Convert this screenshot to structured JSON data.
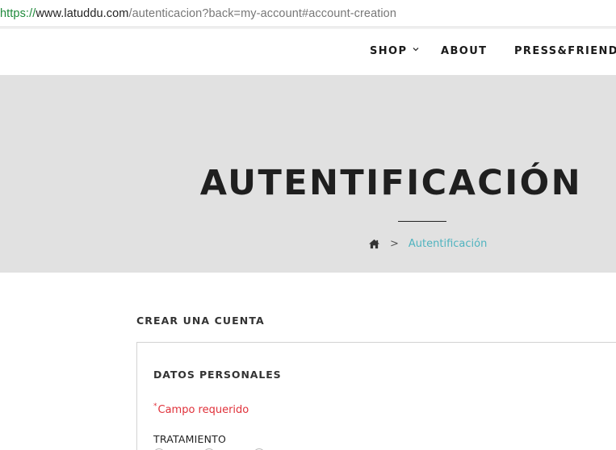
{
  "browser": {
    "url_scheme": "https://",
    "url_host": "www.latuddu.com",
    "url_path": "/autenticacion?back=my-account#account-creation"
  },
  "nav": {
    "items": [
      {
        "label": "SHOP",
        "has_dropdown": true
      },
      {
        "label": "ABOUT",
        "has_dropdown": false
      },
      {
        "label": "PRESS&FRIENDS",
        "has_dropdown": false
      }
    ]
  },
  "banner": {
    "title": "AUTENTIFICACIÓN",
    "breadcrumb": {
      "home_icon": "home-icon",
      "separator": ">",
      "current": "Autentificación"
    }
  },
  "content": {
    "section_title": "CREAR UNA CUENTA",
    "panel_title": "DATOS PERSONALES",
    "required_star": "*",
    "required_text": "Campo requerido",
    "field_label": "TRATAMIENTO"
  },
  "colors": {
    "accent": "#4fb3bf",
    "required": "#e0313a",
    "banner_bg": "#e1e1e1"
  }
}
